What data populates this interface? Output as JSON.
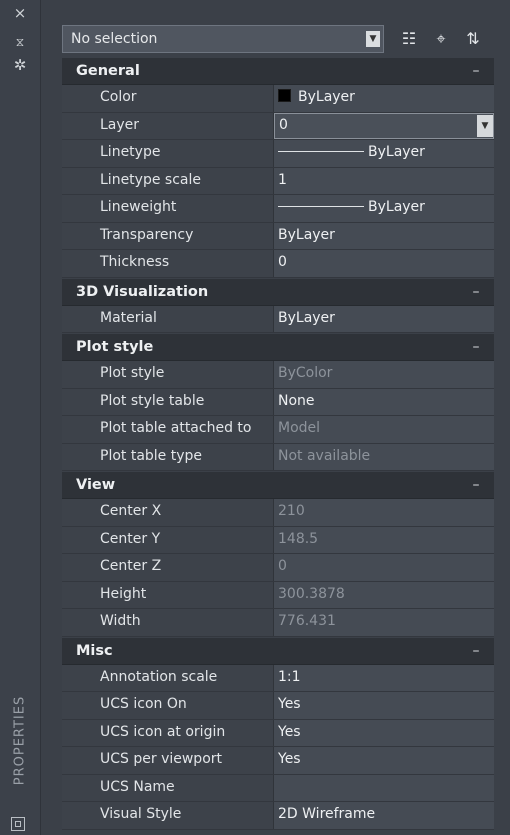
{
  "palette": {
    "panel_bg": "#3b4048",
    "section_header": "#2e3238",
    "label_bg": "#3d424a",
    "value_bg": "#454b54",
    "readonly_text": "#8d939b",
    "color_swatch": "#000000"
  },
  "strip": {
    "close_icon": "×",
    "autohide_icon": "⧖",
    "settings_icon": "✲",
    "title": "PROPERTIES",
    "icons": [
      "close-icon",
      "autohide-icon",
      "settings-icon",
      "properties-window-icon"
    ]
  },
  "toolbar": {
    "selection_value": "No selection",
    "quick_select_icon": "☷",
    "select_objects_icon": "⌖",
    "toggle_pickadd_icon": "⇅"
  },
  "sections": [
    {
      "title": "General",
      "toggle": "–",
      "rows": [
        {
          "label": "Color",
          "value": "ByLayer",
          "kind": "color"
        },
        {
          "label": "Layer",
          "value": "0",
          "kind": "dropdown"
        },
        {
          "label": "Linetype",
          "value": "ByLayer",
          "kind": "line"
        },
        {
          "label": "Linetype scale",
          "value": "1",
          "kind": "text"
        },
        {
          "label": "Lineweight",
          "value": "ByLayer",
          "kind": "line"
        },
        {
          "label": "Transparency",
          "value": "ByLayer",
          "kind": "text"
        },
        {
          "label": "Thickness",
          "value": "0",
          "kind": "text"
        }
      ]
    },
    {
      "title": "3D Visualization",
      "toggle": "–",
      "rows": [
        {
          "label": "Material",
          "value": "ByLayer",
          "kind": "text"
        }
      ]
    },
    {
      "title": "Plot style",
      "toggle": "–",
      "rows": [
        {
          "label": "Plot style",
          "value": "ByColor",
          "kind": "readonly"
        },
        {
          "label": "Plot style table",
          "value": "None",
          "kind": "text"
        },
        {
          "label": "Plot table attached to",
          "value": "Model",
          "kind": "readonly"
        },
        {
          "label": "Plot table type",
          "value": "Not available",
          "kind": "readonly"
        }
      ]
    },
    {
      "title": "View",
      "toggle": "–",
      "rows": [
        {
          "label": "Center X",
          "value": "210",
          "kind": "readonly"
        },
        {
          "label": "Center Y",
          "value": "148.5",
          "kind": "readonly"
        },
        {
          "label": "Center Z",
          "value": "0",
          "kind": "readonly"
        },
        {
          "label": "Height",
          "value": "300.3878",
          "kind": "readonly"
        },
        {
          "label": "Width",
          "value": "776.431",
          "kind": "readonly"
        }
      ]
    },
    {
      "title": "Misc",
      "toggle": "–",
      "rows": [
        {
          "label": "Annotation scale",
          "value": "1:1",
          "kind": "text"
        },
        {
          "label": "UCS icon On",
          "value": "Yes",
          "kind": "text"
        },
        {
          "label": "UCS icon at origin",
          "value": "Yes",
          "kind": "text"
        },
        {
          "label": "UCS per viewport",
          "value": "Yes",
          "kind": "text"
        },
        {
          "label": "UCS Name",
          "value": "",
          "kind": "text"
        },
        {
          "label": "Visual Style",
          "value": "2D Wireframe",
          "kind": "text"
        }
      ]
    }
  ]
}
